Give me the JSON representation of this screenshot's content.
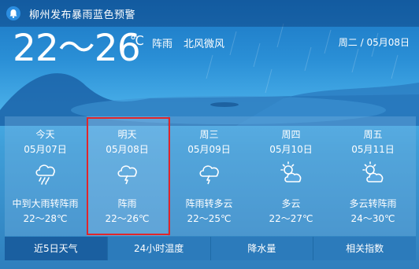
{
  "alert": {
    "text": "柳州发布暴雨蓝色预警",
    "icon": "bell-icon"
  },
  "current": {
    "temperature_range": "22～26",
    "unit": "℃",
    "condition": "阵雨",
    "wind": "北风微风",
    "date": "周二 / 05月08日"
  },
  "forecast": [
    {
      "name": "今天",
      "date": "05月07日",
      "icon": "heavy-rain-icon",
      "condition": "中到大雨转阵雨",
      "range": "22～28℃"
    },
    {
      "name": "明天",
      "date": "05月08日",
      "icon": "thunder-shower-icon",
      "condition": "阵雨",
      "range": "22～26℃"
    },
    {
      "name": "周三",
      "date": "05月09日",
      "icon": "thunder-shower-icon",
      "condition": "阵雨转多云",
      "range": "22～25℃"
    },
    {
      "name": "周四",
      "date": "05月10日",
      "icon": "partly-cloudy-icon",
      "condition": "多云",
      "range": "22～27℃"
    },
    {
      "name": "周五",
      "date": "05月11日",
      "icon": "partly-cloudy-icon",
      "condition": "多云转阵雨",
      "range": "24～30℃"
    }
  ],
  "tabs": [
    {
      "label": "近5日天气",
      "active": true
    },
    {
      "label": "24小时温度",
      "active": false
    },
    {
      "label": "降水量",
      "active": false
    },
    {
      "label": "相关指数",
      "active": false
    }
  ],
  "colors": {
    "highlight_border": "#e0262b",
    "tab_active": "#1a5fa0",
    "tab_inactive": "#2c7bbb"
  }
}
